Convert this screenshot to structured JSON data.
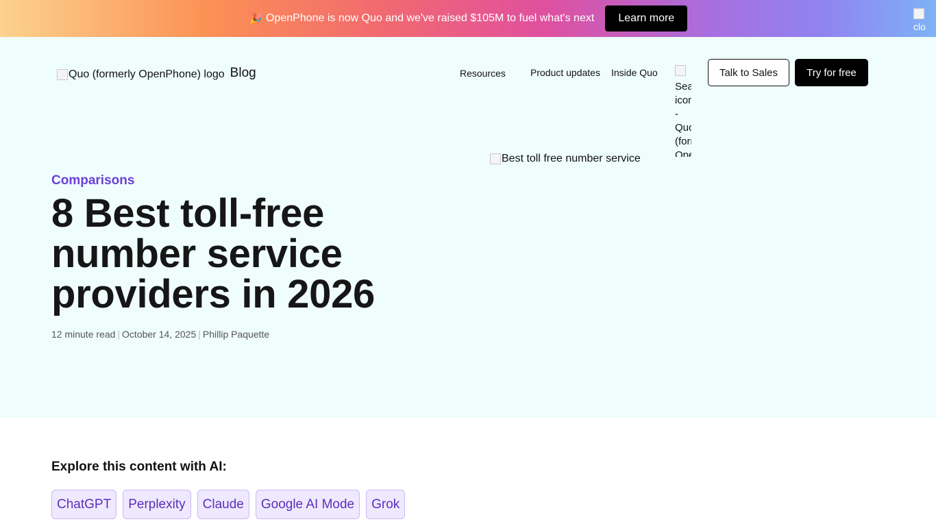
{
  "banner": {
    "emoji": "🎉",
    "text": "OpenPhone is now Quo and we've raised $105M to fuel what's next",
    "cta": "Learn more",
    "close_alt": "clo"
  },
  "header": {
    "logo_alt": "Quo (formerly OpenPhone) logo",
    "blog_label": "Blog",
    "nav": {
      "resources": "Resources",
      "product_updates": "Product updates",
      "inside_quo": "Inside Quo"
    },
    "search_alt": "Search icon - Quo (formerly OpenPhone)",
    "talk_to_sales": "Talk to Sales",
    "try_for_free": "Try for free"
  },
  "article": {
    "category": "Comparisons",
    "title": "8 Best toll-free number service providers in 2026",
    "read_time": "12 minute read",
    "date": "October 14, 2025",
    "author": "Phillip Paquette",
    "separator": "|",
    "hero_image_alt": "Best toll free number service"
  },
  "explore": {
    "title": "Explore this content with AI:",
    "options": [
      "ChatGPT",
      "Perplexity",
      "Claude",
      "Google AI Mode",
      "Grok"
    ]
  },
  "colors": {
    "hero_bg": "#effdfd",
    "accent": "#6c3fd6",
    "chip_bg": "#efe9ff",
    "button_dark": "#000000"
  }
}
